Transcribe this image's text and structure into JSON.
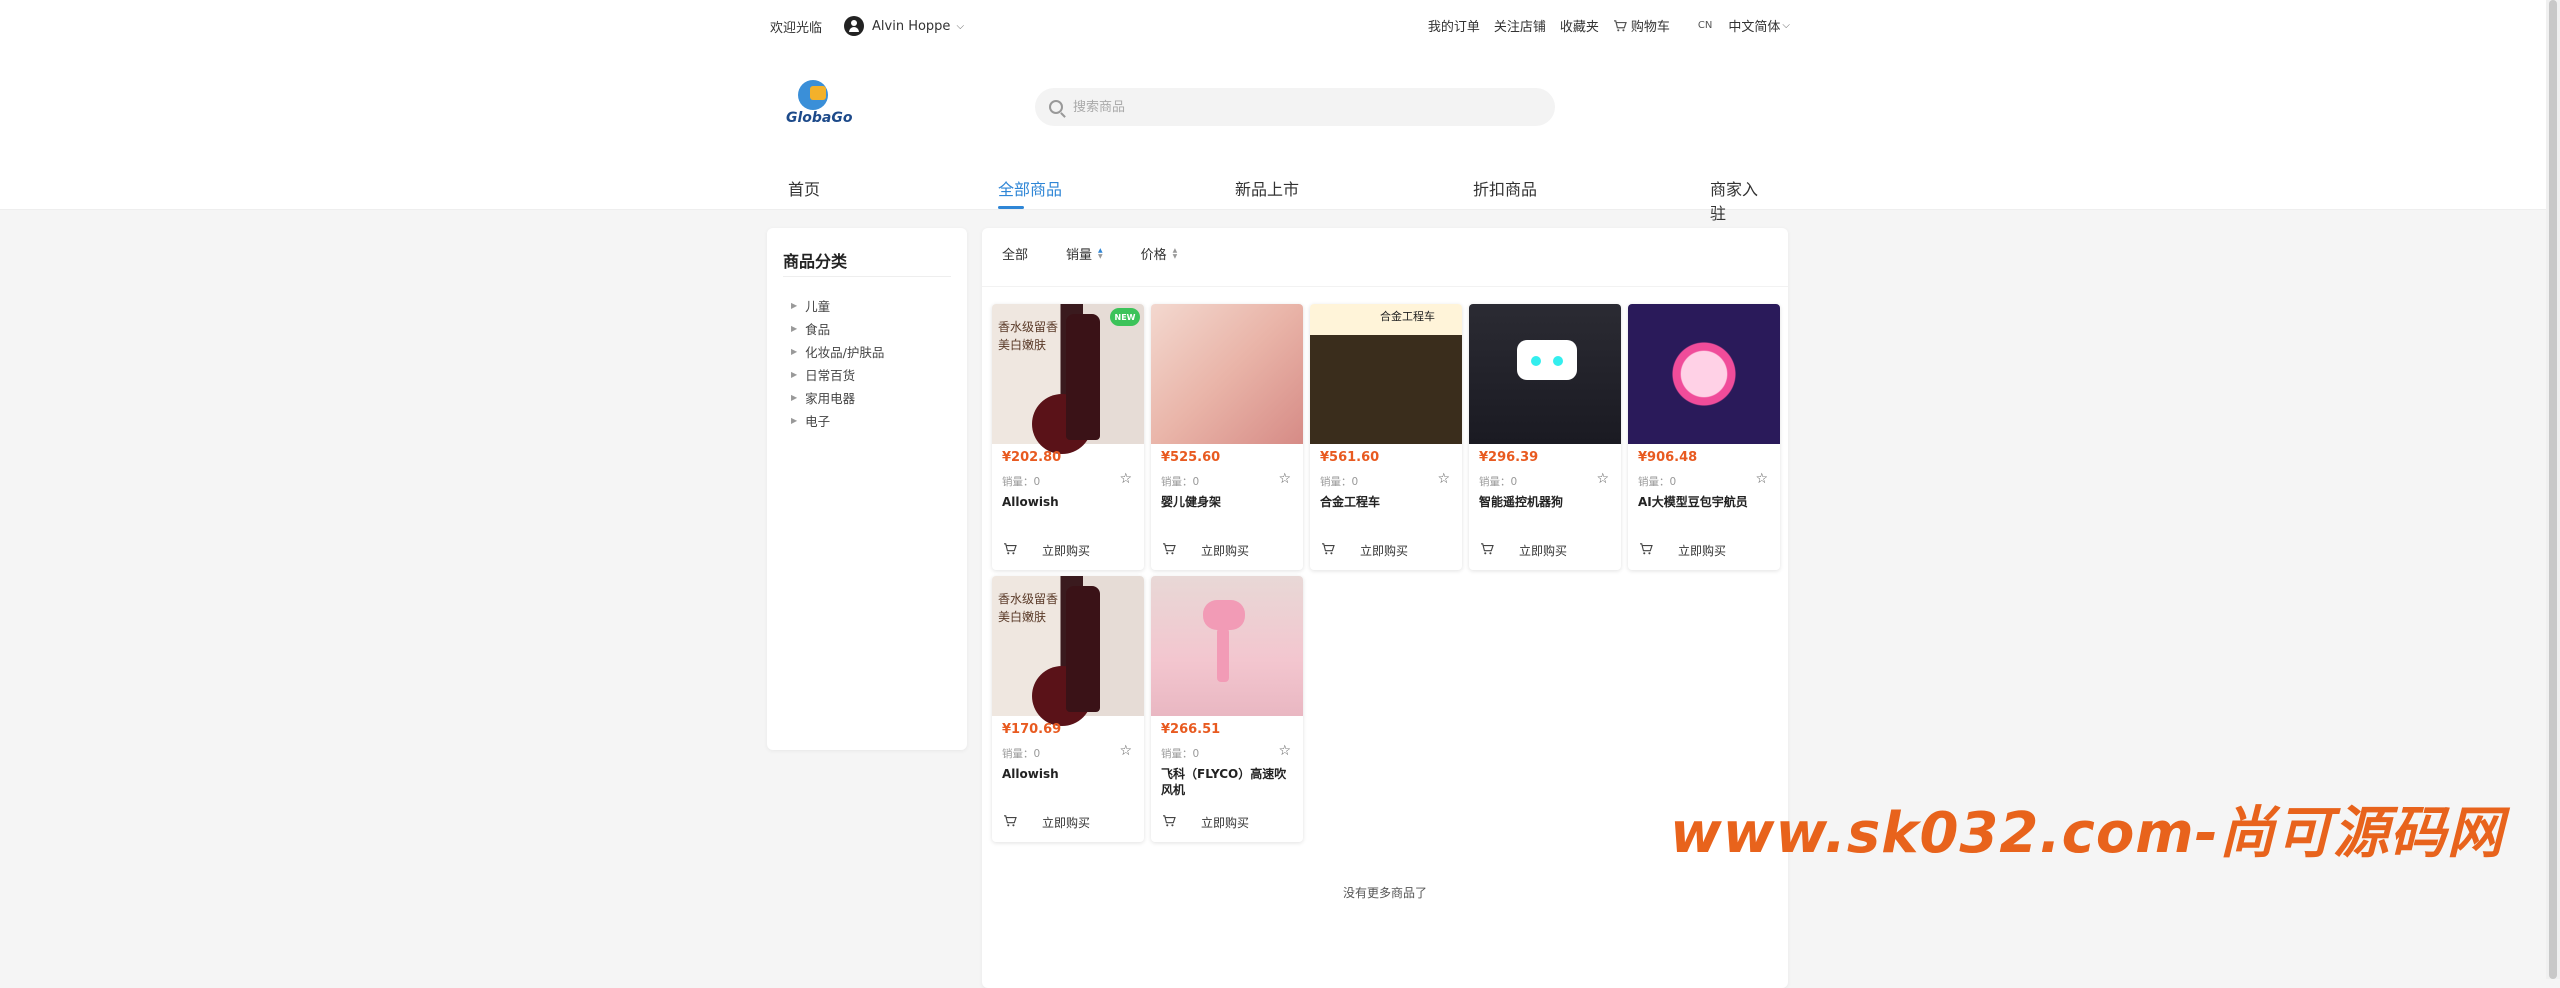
{
  "topbar": {
    "welcome": "欢迎光临",
    "user_name": "Alvin Hoppe",
    "links": [
      "我的订单",
      "关注店铺",
      "收藏夹"
    ],
    "cart_label": "购物车",
    "lang_code": "CN",
    "lang_label": "中文简体"
  },
  "logo": {
    "text": "GlobaGo"
  },
  "search": {
    "placeholder": "搜索商品"
  },
  "nav": {
    "items": [
      "首页",
      "全部商品",
      "新品上市",
      "折扣商品",
      "商家入驻"
    ],
    "active_index": 1,
    "accent": "#2f86d6"
  },
  "sidebar": {
    "title": "商品分类",
    "categories": [
      "儿童",
      "食品",
      "化妆品/护肤品",
      "日常百货",
      "家用电器",
      "电子"
    ]
  },
  "filters": [
    "全部",
    "销量",
    "价格"
  ],
  "products": [
    {
      "price": "¥202.80",
      "sales": "销量：0",
      "name": "Allowish",
      "badge": "NEW",
      "image_text": "香水级留香美白嫩肤"
    },
    {
      "price": "¥525.60",
      "sales": "销量：0",
      "name": "婴儿健身架"
    },
    {
      "price": "¥561.60",
      "sales": "销量：0",
      "name": "合金工程车",
      "image_text": "合金工程车"
    },
    {
      "price": "¥296.39",
      "sales": "销量：0",
      "name": "智能遥控机器狗"
    },
    {
      "price": "¥906.48",
      "sales": "销量：0",
      "name": "AI大模型豆包宇航员"
    },
    {
      "price": "¥170.69",
      "sales": "销量：0",
      "name": "Allowish",
      "image_text": "香水级留香美白嫩肤"
    },
    {
      "price": "¥266.51",
      "sales": "销量：0",
      "name": "飞科（FLYCO）高速吹风机"
    }
  ],
  "buy_label": "立即购买",
  "no_more": "没有更多商品了",
  "watermark": "www.sk032.com-尚可源码网",
  "colors": {
    "price": "#e85a20",
    "watermark": "#e8631c"
  }
}
